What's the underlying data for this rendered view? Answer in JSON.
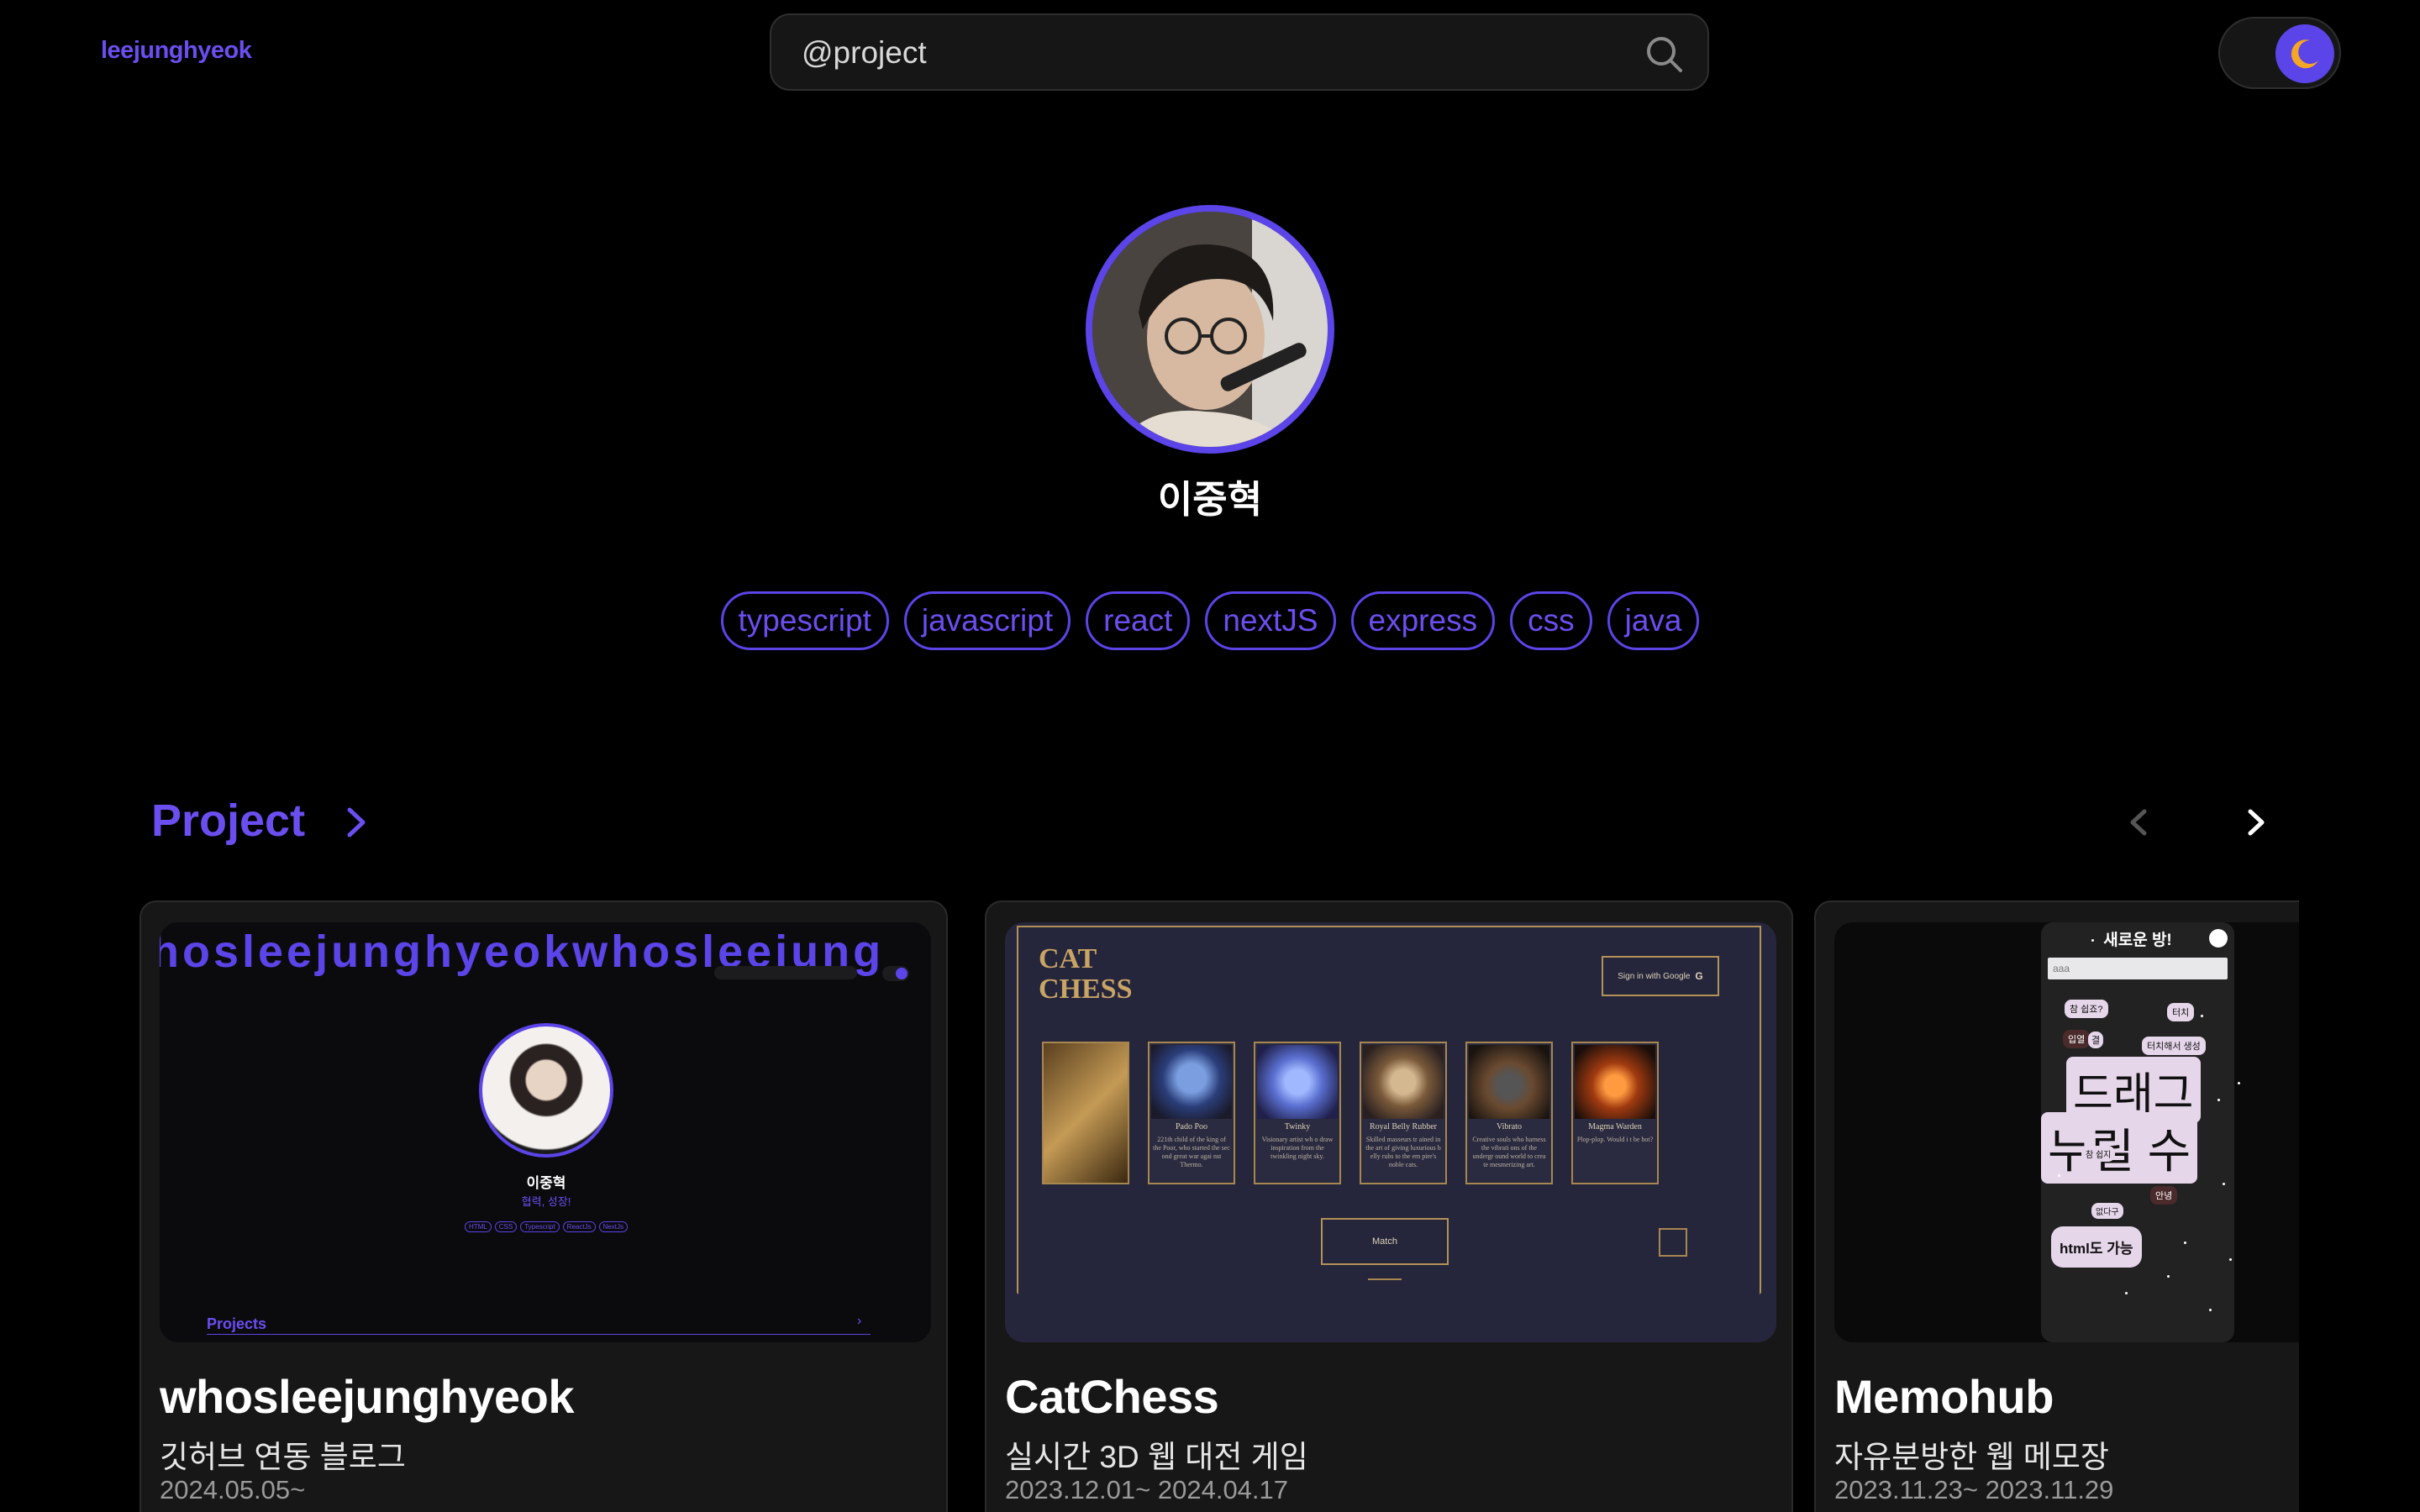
{
  "header": {
    "logo": "leejunghyeok",
    "search_value": "@project",
    "search_icon": "search-icon",
    "theme_icon": "moon-icon"
  },
  "profile": {
    "name": "이중혁",
    "tags": [
      "typescript",
      "javascript",
      "react",
      "nextJS",
      "express",
      "css",
      "java"
    ]
  },
  "section": {
    "title": "Project"
  },
  "projects": [
    {
      "title": "whosleejunghyeok",
      "subtitle": "깃허브 연동 블로그",
      "date": "2024.05.05~",
      "thumb": {
        "marquee": "hosleejunghyeokwhosleejung",
        "name": "이중혁",
        "desc": "협력, 성장!",
        "tags": [
          "HTML",
          "CSS",
          "Typescript",
          "ReactJs",
          "NextJs"
        ],
        "section": "Projects"
      }
    },
    {
      "title": "CatChess",
      "subtitle": "실시간 3D 웹 대전 게임",
      "date": "2023.12.01~ 2024.04.17",
      "thumb": {
        "logo_line1": "CAT",
        "logo_line2": "CHESS",
        "signin": "Sign in with Google",
        "match": "Match",
        "cards": [
          {
            "name": "",
            "desc": ""
          },
          {
            "name": "Pado Poo",
            "desc": "221th child of the king of the Poor, who started the sec ond great war agai nst Thermo."
          },
          {
            "name": "Twinky",
            "desc": "Visionary artist wh o draw inspiration from the twinkling night sky."
          },
          {
            "name": "Royal Belly Rubber",
            "desc": "Skilled masseurs tr ained in the art of giving luxurious b elly rubs to the em pire's noble cats."
          },
          {
            "name": "Vibrato",
            "desc": "Creative souls who harness the vibrati ons of the undergr ound world to crea te mesmerizing art."
          },
          {
            "name": "Magma Warden",
            "desc": "Plop-plop. Would i t be hot?"
          }
        ]
      }
    },
    {
      "title": "Memohub",
      "subtitle": "자유분방한 웹 메모장",
      "date": "2023.11.23~ 2023.11.29",
      "thumb": {
        "room_title": "새로운 방!",
        "input_value": "aaa",
        "bubbles": [
          "참 쉽죠?",
          "터치",
          "입열",
          "결",
          "터치해서 생성",
          "드래그",
          "누릴 수",
          "참 쉽지",
          "없다구",
          "안녕",
          "html도 가능"
        ]
      }
    }
  ],
  "colors": {
    "accent": "#5b44e8",
    "moon": "#f5a623",
    "background": "#000000",
    "card": "#171717"
  }
}
